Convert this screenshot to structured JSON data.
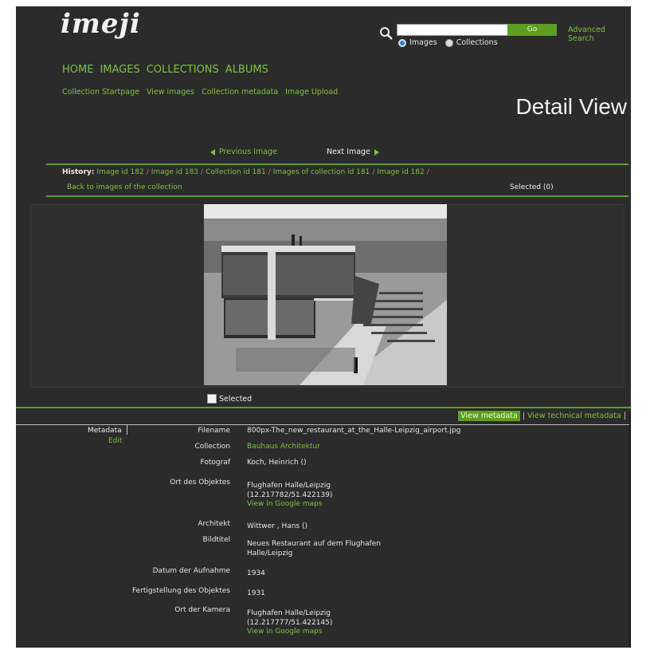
{
  "header": {
    "logo": "imeji",
    "search": {
      "placeholder": "",
      "go_label": "Go",
      "advanced_label": "Advanced Search"
    },
    "scope_options": [
      {
        "label": "Images",
        "selected": true
      },
      {
        "label": "Collections",
        "selected": false
      }
    ]
  },
  "main_nav": [
    "HOME",
    "IMAGES",
    "COLLECTIONS",
    "ALBUMS"
  ],
  "sub_nav": [
    "Collection Startpage",
    "View images",
    "Collection metadata",
    "Image Upload"
  ],
  "page_title": "Detail View",
  "pager": {
    "previous": "Previous Image",
    "next": "Next Image"
  },
  "history": {
    "label": "History:",
    "items": [
      "Image id 182",
      "Image id 183",
      "Collection id 181",
      "Images of collection id 181",
      "Image id 182"
    ]
  },
  "back_link": "Back to images of the collection",
  "selected_count": "Selected (0)",
  "select_checkbox_label": "Selected",
  "view_tabs": {
    "active": "View metadata",
    "other": "View technical metadata"
  },
  "metadata_panel": {
    "label": "Metadata",
    "edit": "Edit"
  },
  "metadata": {
    "filename": {
      "key": "Filename",
      "value": "800px-The_new_restaurant_at_the_Halle-Leipzig_airport.jpg"
    },
    "collection": {
      "key": "Collection",
      "value": "Bauhaus Architektur"
    },
    "fotograf": {
      "key": "Fotograf",
      "value": "Koch, Heinrich ()"
    },
    "ort_objekt": {
      "key": "Ort des Objektes",
      "line1": "Flughafen Halle/Leipzig",
      "line2": "(12.217782/51.422139)",
      "link": "View in Google maps"
    },
    "architekt": {
      "key": "Architekt",
      "value": "Wittwer , Hans ()"
    },
    "bildtitel": {
      "key": "Bildtitel",
      "line1": "Neues Restaurant auf dem Flughafen",
      "line2": "Halle/Leipzig"
    },
    "datum": {
      "key": "Datum der Aufnahme",
      "value": "1934"
    },
    "fertigstellung": {
      "key": "Fertigstellung des Objektes",
      "value": "1931"
    },
    "ort_kamera": {
      "key": "Ort der Kamera",
      "line1": "Flughafen Halle/Leipzig",
      "line2": "(12.217777/51.422145)",
      "link": "View in Google maps"
    }
  },
  "colors": {
    "background": "#2b2b2b",
    "accent": "#7fc241",
    "button": "#5d9e23",
    "text": "#eeeeee"
  }
}
